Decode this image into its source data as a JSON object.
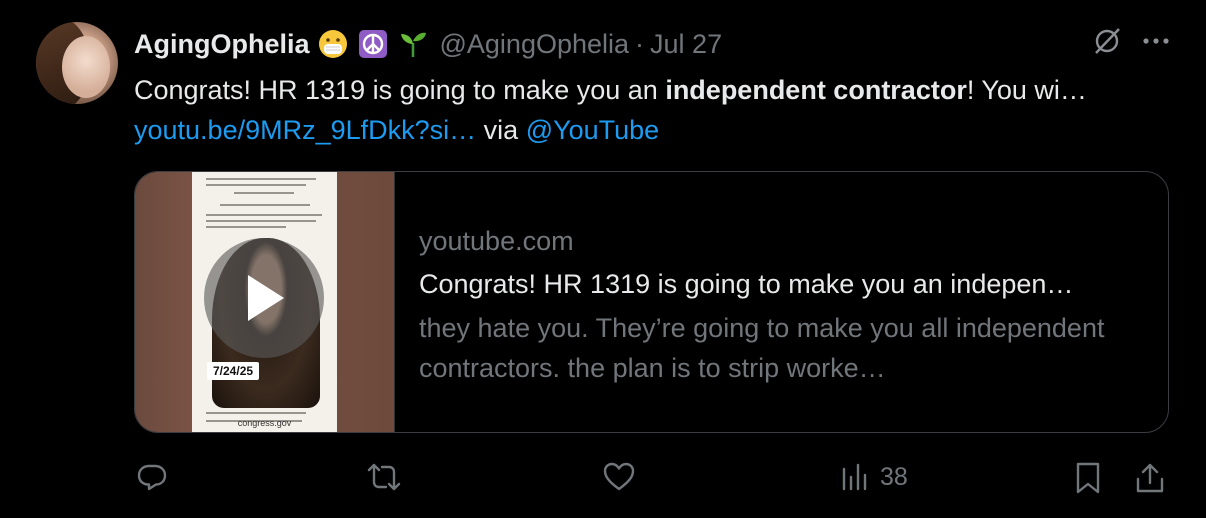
{
  "author": {
    "display_name": "AgingOphelia",
    "emojis": [
      "mask-face-emoji",
      "peace-symbol-emoji",
      "seedling-emoji"
    ],
    "handle": "@AgingOphelia",
    "separator": "·",
    "date": "Jul 27"
  },
  "tweet": {
    "text_part1": "Congrats! HR 1319 is going to make you an ",
    "text_bold": "independent contractor",
    "text_part2": "! You wi… ",
    "link": "youtu.be/9MRz_9LfDkk?si…",
    "via": " via ",
    "mention": "@YouTube"
  },
  "card": {
    "domain": "youtube.com",
    "title": "Congrats! HR 1319 is going to make you an indepen…",
    "description": "they hate you. They’re going to make you all independent contractors. the plan is to strip worke…",
    "thumbnail_date": "7/24/25",
    "thumbnail_footer": "congress.gov"
  },
  "actions": {
    "views_count": "38"
  },
  "colors": {
    "background": "#000000",
    "text": "#e7e9ea",
    "muted": "#71767b",
    "link": "#1d9bf0"
  }
}
